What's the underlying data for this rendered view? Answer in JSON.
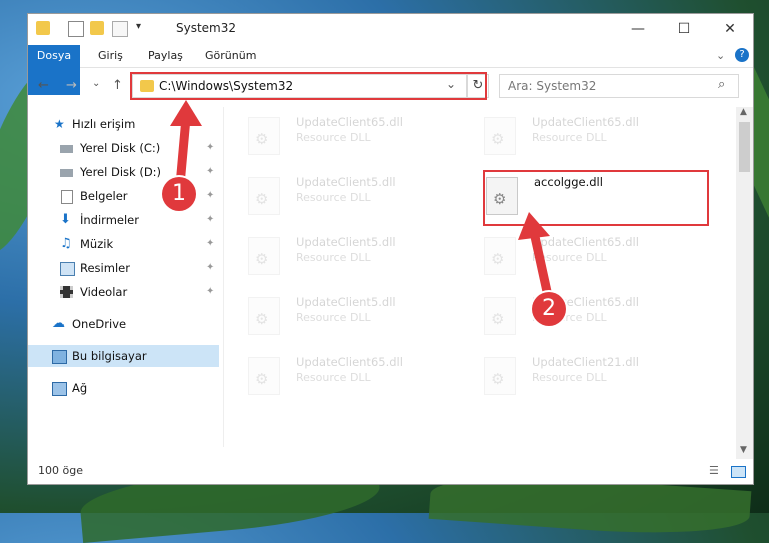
{
  "window": {
    "title": "System32",
    "controls": {
      "minimize": "—",
      "maximize": "☐",
      "close": "✕"
    }
  },
  "ribbon": {
    "tabs": [
      "Dosya",
      "Giriş",
      "Paylaş",
      "Görünüm"
    ],
    "help": "?"
  },
  "nav": {
    "back": "←",
    "forward": "→",
    "recent": "⌄",
    "up": "↑",
    "address": "C:\\Windows\\System32",
    "address_dropdown": "⌄",
    "refresh": "↻",
    "search_placeholder": "Ara: System32"
  },
  "sidebar": {
    "items": [
      {
        "label": "Hızlı erişim",
        "icon": "star-icon"
      },
      {
        "label": "Yerel Disk (C:)",
        "icon": "drive-icon",
        "pinned": true
      },
      {
        "label": "Yerel Disk (D:)",
        "icon": "drive-icon",
        "pinned": true
      },
      {
        "label": "Belgeler",
        "icon": "document-icon",
        "pinned": true
      },
      {
        "label": "İndirmeler",
        "icon": "download-icon",
        "pinned": true
      },
      {
        "label": "Müzik",
        "icon": "music-icon",
        "pinned": true
      },
      {
        "label": "Resimler",
        "icon": "picture-icon",
        "pinned": true
      },
      {
        "label": "Videolar",
        "icon": "video-icon",
        "pinned": true
      },
      {
        "label": "OneDrive",
        "icon": "cloud-icon"
      },
      {
        "label": "Bu bilgisayar",
        "icon": "computer-icon",
        "selected": true
      },
      {
        "label": "Ağ",
        "icon": "network-icon"
      }
    ],
    "pin_glyph": "📌"
  },
  "files": [
    {
      "name": "UpdateClient65.dll",
      "type": "Resource DLL",
      "faded": true
    },
    {
      "name": "UpdateClient65.dll",
      "type": "Resource DLL",
      "faded": true
    },
    {
      "name": "UpdateClient5.dll",
      "type": "Resource DLL",
      "faded": true
    },
    {
      "name": "accolgge.dll",
      "type": "",
      "faded": false
    },
    {
      "name": "UpdateClient5.dll",
      "type": "Resource DLL",
      "faded": true
    },
    {
      "name": "UpdateClient65.dll",
      "type": "Resource DLL",
      "faded": true
    },
    {
      "name": "UpdateClient5.dll",
      "type": "Resource DLL",
      "faded": true
    },
    {
      "name": "UpdateClient65.dll",
      "type": "Resource DLL",
      "faded": true
    },
    {
      "name": "UpdateClient65.dll",
      "type": "Resource DLL",
      "faded": true
    },
    {
      "name": "UpdateClient21.dll",
      "type": "Resource DLL",
      "faded": true
    }
  ],
  "status": {
    "count": "100 öge"
  },
  "annotations": {
    "step1": "1",
    "step2": "2",
    "color": "#e0393c"
  }
}
